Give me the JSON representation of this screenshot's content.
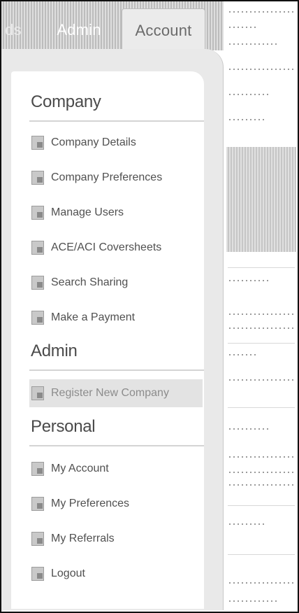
{
  "tabs": {
    "prev_label": "ds",
    "admin_label": "Admin",
    "account_label": "Account"
  },
  "menu": {
    "sections": [
      {
        "title": "Company",
        "items": [
          {
            "label": "Company Details",
            "icon": "document-edit-icon"
          },
          {
            "label": "Company Preferences",
            "icon": "document-edit-icon"
          },
          {
            "label": "Manage Users",
            "icon": "users-document-icon"
          },
          {
            "label": "ACE/ACI Coversheets",
            "icon": "coversheet-icon"
          },
          {
            "label": "Search Sharing",
            "icon": "share-user-icon"
          },
          {
            "label": "Make a Payment",
            "icon": "document-edit-icon"
          }
        ]
      },
      {
        "title": "Admin",
        "items": [
          {
            "label": "Register New Company",
            "icon": "users-document-icon",
            "highlighted": true
          }
        ]
      },
      {
        "title": "Personal",
        "items": [
          {
            "label": "My Account",
            "icon": "share-user-icon"
          },
          {
            "label": "My Preferences",
            "icon": "preferences-icon"
          },
          {
            "label": "My Referrals",
            "icon": "users-document-icon"
          },
          {
            "label": "Logout",
            "icon": "logout-icon"
          }
        ]
      }
    ]
  }
}
